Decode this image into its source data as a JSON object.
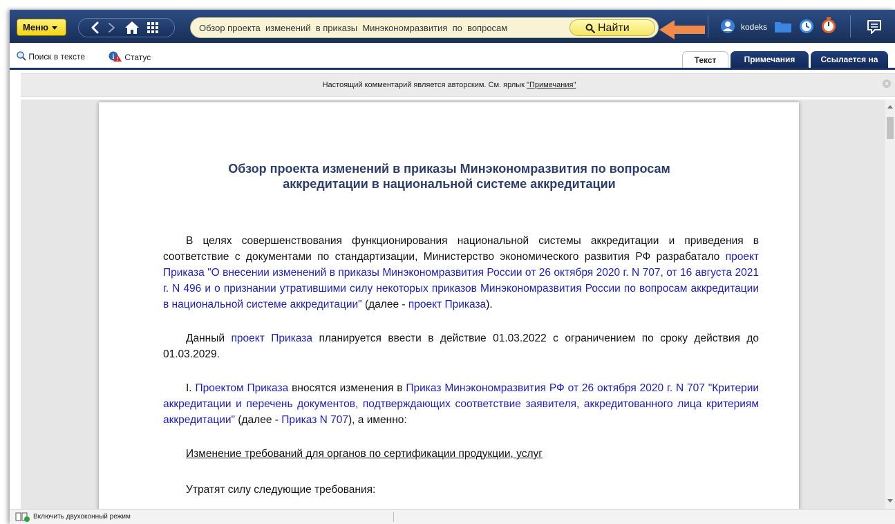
{
  "toolbar": {
    "menu_label": "Меню",
    "search_value": "Обзор проекта  изменений  в приказы  Минэкономразвития  по  вопросам",
    "find_label": "Найти",
    "user_name": "kodeks"
  },
  "subtoolbar": {
    "search_in_text": "Поиск в тексте",
    "status": "Статус"
  },
  "tabs": [
    {
      "label": "Текст",
      "active": true
    },
    {
      "label": "Примечания",
      "active": false
    },
    {
      "label": "Ссылается на",
      "active": false
    }
  ],
  "notice": {
    "text": "Настоящий комментарий является авторским. См. ярлык ",
    "link": "\"Примечания\""
  },
  "document": {
    "title_line1": "Обзор проекта изменений в приказы Минэкономразвития по вопросам",
    "title_line2": "аккредитации в национальной системе аккредитации",
    "p1_text1": "В целях совершенствования функционирования национальной системы аккредитации и приведения в соответствие с документами по стандартизации, Министерство экономического развития РФ разрабатало ",
    "p1_link1": "проект Приказа \"О внесении изменений в приказы Минэкономразвития России от 26 октября 2020 г. N 707, от 16 августа 2021 г. N 496 и о признании утратившими силу некоторых приказов Минэкономразвития России по вопросам аккредитации в национальной системе аккредитации\"",
    "p1_text2": " (далее - ",
    "p1_link2": "проект Приказа",
    "p1_text3": ").",
    "p2_text1": "Данный ",
    "p2_link1": "проект Приказа",
    "p2_text2": " планируется ввести в действие 01.03.2022 с ограничением по сроку действия до 01.03.2029.",
    "p3_text1": "I. ",
    "p3_link1": "Проектом Приказа",
    "p3_text2": " вносятся изменения в ",
    "p3_link2": "Приказ Минэкономразвития РФ от 26 октября 2020 г. N 707 \"Критерии аккредитации и перечень документов, подтверждающих соответствие заявителя, аккредитованного лица критериям аккредитации\"",
    "p3_text3": " (далее - ",
    "p3_link3": "Приказ N 707",
    "p3_text4": "), а именно:",
    "p4_underlined": "Изменение требований для органов по сертификации продукции, услуг",
    "p5_text": "Утратят силу следующие требования:"
  },
  "statusbar": {
    "dual_window": "Включить двухоконный режим"
  },
  "colors": {
    "topbar": "#203c6c",
    "menu_yellow": "#f3d414",
    "link_blue": "#1d1dc4",
    "title_blue": "#2c3e6e",
    "arrow_orange": "#f08a4b"
  }
}
